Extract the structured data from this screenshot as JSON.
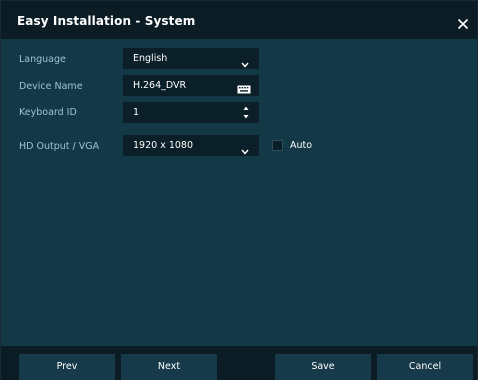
{
  "window": {
    "title": "Easy Installation - System"
  },
  "fields": {
    "language": {
      "label": "Language",
      "value": "English"
    },
    "device": {
      "label": "Device Name",
      "value": "H.264_DVR"
    },
    "keyboard": {
      "label": "Keyboard ID",
      "value": "1"
    },
    "hd_output": {
      "label": "HD Output / VGA",
      "value": "1920 x 1080"
    }
  },
  "auto": {
    "label": "Auto",
    "checked": false
  },
  "footer": {
    "prev": "Prev",
    "next": "Next",
    "save": "Save",
    "cancel": "Cancel"
  },
  "icons": {
    "close": "close-icon",
    "dropdown": "chevron-down-icon",
    "keyboard": "keyboard-icon",
    "spinner": "spinner-arrows-icon"
  },
  "colors": {
    "background": "#133846",
    "titlebar": "#0c1c25",
    "field": "#0b1f29",
    "label": "#9ec3da",
    "button": "#163a49"
  }
}
